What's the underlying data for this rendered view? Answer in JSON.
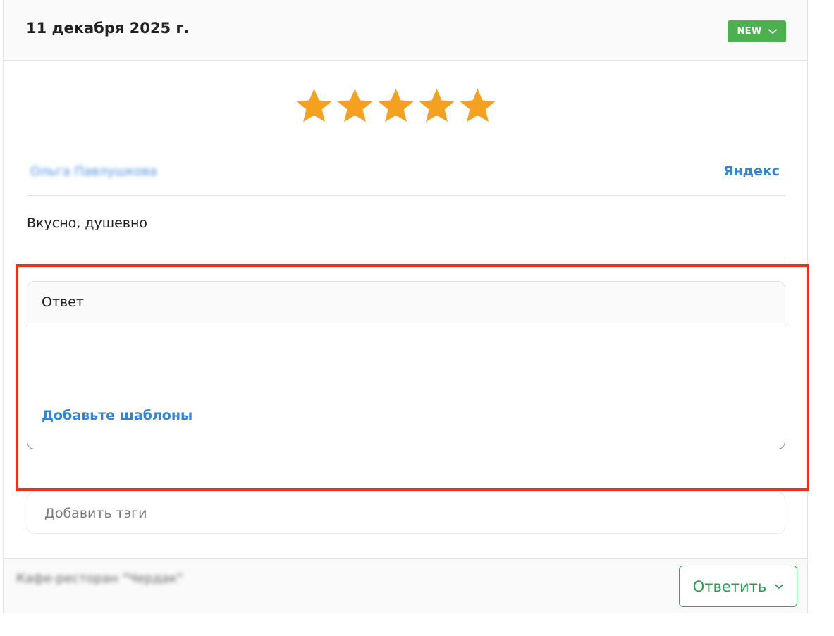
{
  "review": {
    "date": "11 декабря 2025 г.",
    "status": "NEW",
    "rating": 5,
    "author": "Ольга Павлушкова",
    "source": "Яндекс",
    "text": "Вкусно, душевно"
  },
  "reply": {
    "title": "Ответ",
    "templates_link": "Добавьте шаблоны"
  },
  "tags": {
    "placeholder": "Добавить тэги"
  },
  "footer": {
    "location": "Кафе-ресторан \"Чердак\"",
    "reply_button": "Ответить"
  },
  "colors": {
    "star": "#f4a021",
    "badge": "#4caf50",
    "link": "#2f86d8",
    "accent_green": "#23a24a",
    "highlight": "#ff2a12"
  }
}
